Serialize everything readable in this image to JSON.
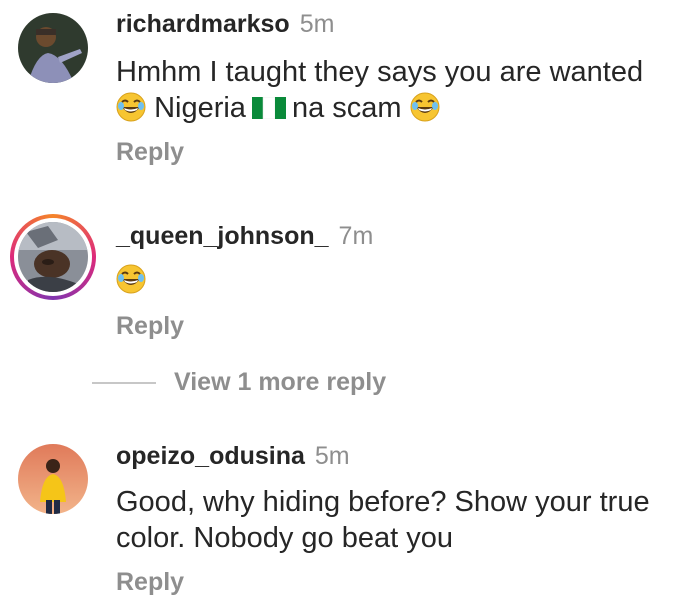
{
  "comments": [
    {
      "username": "richardmarkso",
      "time": "5m",
      "line1": "Hmhm I taught they says you are wanted",
      "line2_a": "Nigeria",
      "line2_b": "na scam",
      "reply_label": "Reply"
    },
    {
      "username": "_queen_johnson_",
      "time": "7m",
      "reply_label": "Reply"
    },
    {
      "username": "opeizo_odusina",
      "time": "5m",
      "line1": "Good, why hiding before? Show your true",
      "line2": "color. Nobody go beat you",
      "reply_label": "Reply"
    }
  ],
  "view_more_label": "View 1 more reply",
  "colors": {
    "username": "#262626",
    "meta_gray": "#8e8e8e",
    "story_ring": [
      "#f58529",
      "#dd2a7b",
      "#8134af"
    ]
  },
  "icons": [
    "laughing-emoji-icon",
    "nigeria-flag-icon"
  ]
}
